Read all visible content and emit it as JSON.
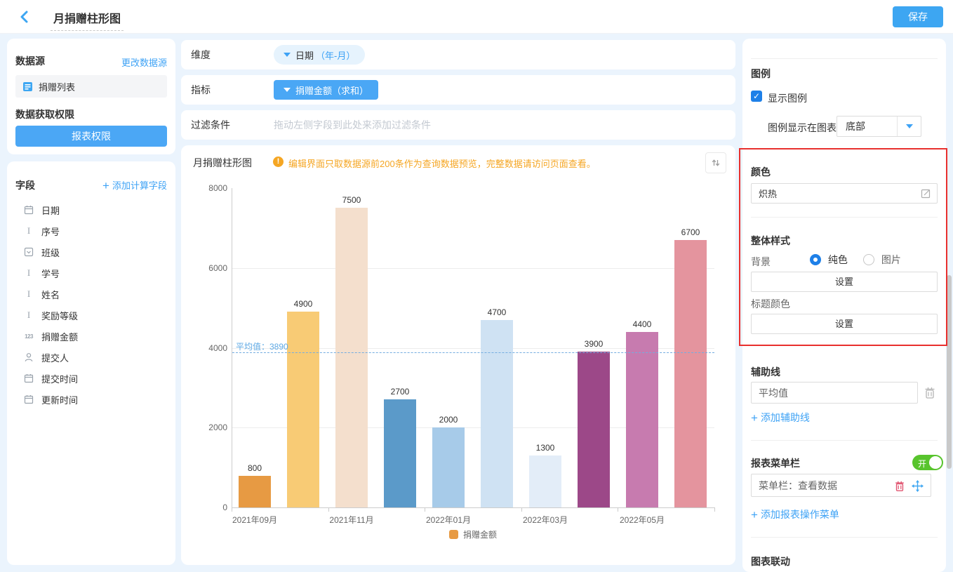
{
  "topbar": {
    "title": "月捐赠柱形图",
    "save_label": "保存"
  },
  "left_panel": {
    "datasource_card": {
      "title": "数据源",
      "change_link": "更改数据源",
      "datasource_item": "捐赠列表",
      "permission_title": "数据获取权限",
      "permission_button": "报表权限"
    },
    "fields_card": {
      "title": "字段",
      "add_calc_field": "添加计算字段",
      "fields": [
        {
          "icon": "calendar",
          "label": "日期"
        },
        {
          "icon": "text",
          "label": "序号"
        },
        {
          "icon": "select",
          "label": "班级"
        },
        {
          "icon": "text",
          "label": "学号"
        },
        {
          "icon": "text",
          "label": "姓名"
        },
        {
          "icon": "text",
          "label": "奖励等级"
        },
        {
          "icon": "number",
          "label": "捐赠金额"
        },
        {
          "icon": "person",
          "label": "提交人"
        },
        {
          "icon": "calendar",
          "label": "提交时间"
        },
        {
          "icon": "calendar",
          "label": "更新时间"
        }
      ]
    }
  },
  "config": {
    "dimension_label": "维度",
    "dimension_chip_name": "日期",
    "dimension_chip_suffix": "（年-月）",
    "metric_label": "指标",
    "metric_chip": "捐赠金额（求和）",
    "filter_label": "过滤条件",
    "filter_placeholder": "拖动左侧字段到此处来添加过滤条件"
  },
  "chart_card": {
    "title": "月捐赠柱形图",
    "warning_mark": "!",
    "warning": "编辑界面只取数据源前200条作为查询数据预览，完整数据请访问页面查看。"
  },
  "chart_data": {
    "type": "bar",
    "title": "月捐赠柱形图",
    "values": [
      800,
      4900,
      7500,
      2700,
      2000,
      4700,
      1300,
      3900,
      4400,
      6700
    ],
    "bar_colors": [
      "#E79A43",
      "#F8CB75",
      "#F4DFCD",
      "#5B9AC9",
      "#A7CBE9",
      "#CFE2F3",
      "#E3EDF8",
      "#9C4888",
      "#C77BAF",
      "#E4949E"
    ],
    "x_tick_labels": [
      "2021年09月",
      "2021年11月",
      "2022年01月",
      "2022年03月",
      "2022年05月"
    ],
    "y_ticks": [
      0,
      2000,
      4000,
      6000,
      8000
    ],
    "ylim": [
      0,
      8000
    ],
    "grid": true,
    "reference_line": {
      "value": 3890,
      "label": "平均值：3890"
    },
    "legend": {
      "position": "bottom",
      "items": [
        {
          "label": "捐赠金额",
          "color": "#E79A43"
        }
      ]
    }
  },
  "right_panel": {
    "legend_section": {
      "title": "图例",
      "show_legend_label": "显示图例",
      "show_legend_checked": "✓",
      "position_label": "图例显示在图表",
      "position_value": "底部"
    },
    "color_section": {
      "title": "颜色",
      "value": "炽热"
    },
    "style_section": {
      "title": "整体样式",
      "bg_label": "背景",
      "bg_option_solid": "纯色",
      "bg_option_image": "图片",
      "bg_selected": "纯色",
      "bg_set_button": "设置",
      "title_color_label": "标题颜色",
      "title_color_button": "设置"
    },
    "refline_section": {
      "title": "辅助线",
      "item": "平均值",
      "add_link": "添加辅助线"
    },
    "menu_section": {
      "title": "报表菜单栏",
      "toggle_label": "开",
      "item": "菜单栏：查看数据",
      "add_link": "添加报表操作菜单"
    },
    "linkage_section": {
      "title": "图表联动"
    }
  },
  "colors": {
    "accent_blue": "#3da6f2",
    "warning_orange": "#f5a623",
    "toggle_green": "#58c42d",
    "highlight_red": "#e8302e",
    "avg_line_blue": "#74ade0"
  }
}
